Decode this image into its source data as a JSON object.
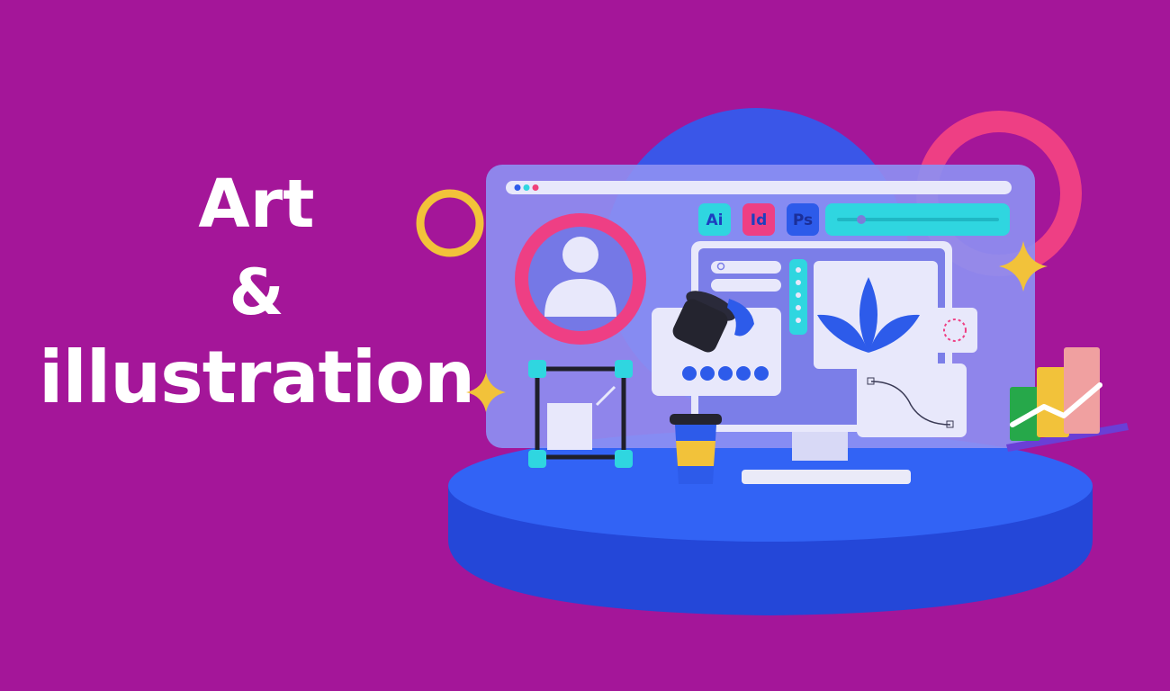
{
  "headline": {
    "line1": "Art",
    "line2": "&",
    "line3": "illustration"
  },
  "badges": {
    "ai": "Ai",
    "id": "Id",
    "ps": "Ps"
  },
  "colors": {
    "background": "#a41699",
    "platform": "#2f5df0",
    "window": "#8a8cf0",
    "accent_cyan": "#2fd6e0",
    "accent_pink": "#f0407a",
    "accent_yellow": "#f2c23a"
  },
  "icons": [
    "user-avatar-icon",
    "paint-bucket-icon",
    "leaf-logo-icon",
    "coffee-cup-icon",
    "bar-chart-icon",
    "star-icon",
    "ring-icon",
    "transform-box-icon",
    "bezier-curve-icon",
    "search-icon",
    "keyboard-icon"
  ]
}
